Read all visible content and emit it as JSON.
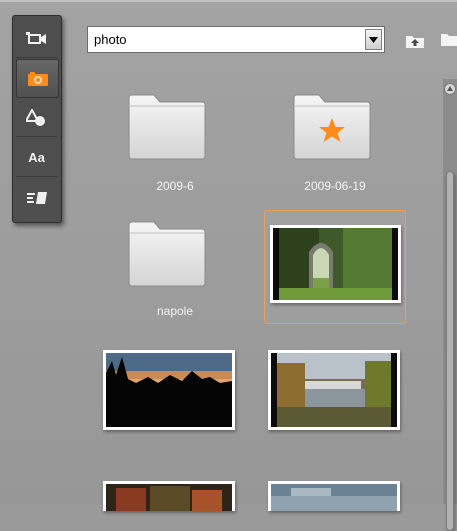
{
  "toolbar": {
    "tools": [
      {
        "name": "video",
        "icon": "video-camera-icon"
      },
      {
        "name": "photo",
        "icon": "photo-camera-icon",
        "active": true,
        "accent": "#ff8a1e"
      },
      {
        "name": "shapes",
        "icon": "shapes-icon"
      },
      {
        "name": "titles",
        "icon": "text-aa-icon",
        "label": "Aa"
      },
      {
        "name": "transitions",
        "icon": "transition-icon"
      }
    ]
  },
  "path_bar": {
    "value": "photo"
  },
  "items": [
    {
      "kind": "folder",
      "caption": "2009-6"
    },
    {
      "kind": "folder",
      "caption": "2009-06-19",
      "badge": "star",
      "badge_color": "#ff8c1a"
    },
    {
      "kind": "folder",
      "caption": "napole"
    },
    {
      "kind": "photo",
      "selected": true,
      "subject": "garden-arch"
    },
    {
      "kind": "photo",
      "subject": "sunset-silhouette"
    },
    {
      "kind": "photo",
      "subject": "harbor"
    },
    {
      "kind": "photo",
      "subject": "autumn-trees"
    },
    {
      "kind": "photo",
      "subject": "sky"
    }
  ],
  "colors": {
    "panel_bg": "#9a9a9a",
    "selection": "#f0a04a"
  }
}
